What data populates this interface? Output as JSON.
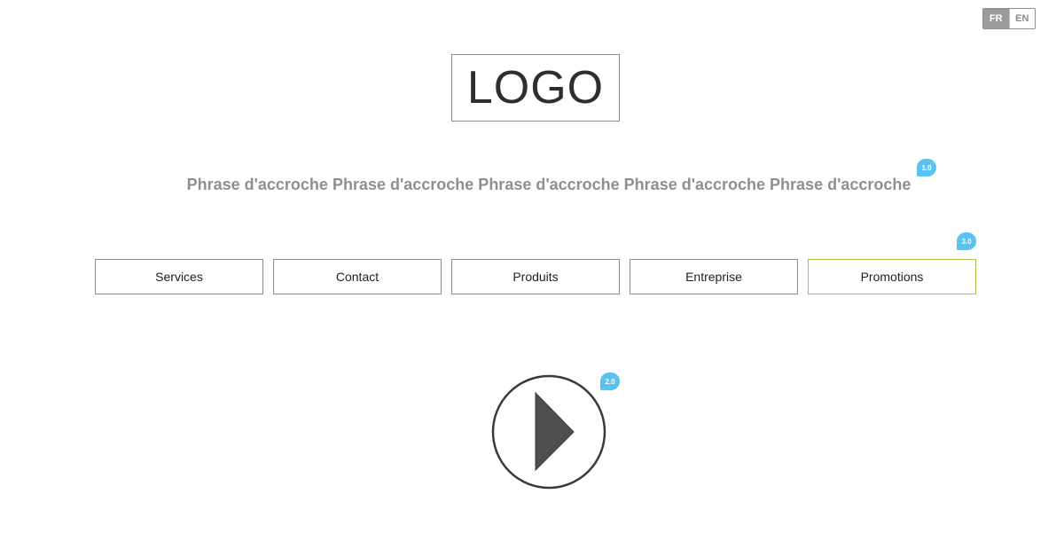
{
  "language_switch": {
    "options": [
      {
        "label": "FR",
        "active": true
      },
      {
        "label": "EN",
        "active": false
      }
    ]
  },
  "logo": {
    "text": "LOGO"
  },
  "tagline": {
    "text": "Phrase d'accroche Phrase d'accroche Phrase d'accroche Phrase d'accroche Phrase d'accroche"
  },
  "annotations": {
    "tagline_marker": "1.0",
    "video_marker": "2.0",
    "nav_marker": "3.0"
  },
  "nav": {
    "items": [
      {
        "label": "Services"
      },
      {
        "label": "Contact"
      },
      {
        "label": "Produits"
      },
      {
        "label": "Entreprise"
      },
      {
        "label": "Promotions"
      }
    ]
  },
  "video": {
    "icon": "play-icon"
  },
  "colors": {
    "annotation_pin": "#59c2ef",
    "promo_border": "#a4c64a",
    "lang_active_bg": "#9b9b9b",
    "tagline_text": "#8f8f8f"
  }
}
